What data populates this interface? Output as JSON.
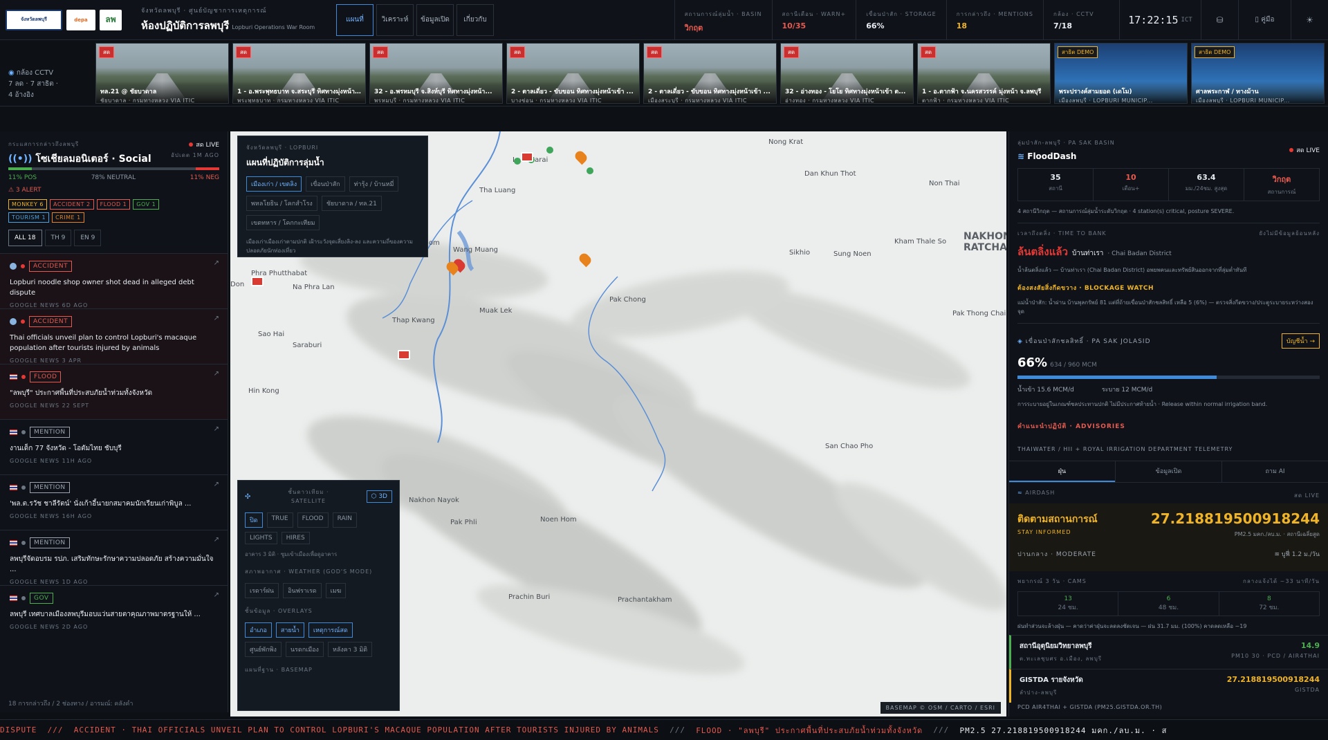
{
  "header": {
    "logos": [
      "จังหวัดลพบุรี",
      "depa",
      "ลพ"
    ],
    "subtitle": "จังหวัดลพบุรี · ศูนย์บัญชาการเหตุการณ์",
    "title": "ห้องปฏิบัติการลพบุรี",
    "title_en": "Lopburi Operations War Room",
    "tabs": [
      "แผนที่",
      "วิเคราะห์",
      "ข้อมูลเปิด",
      "เกี่ยวกับ"
    ],
    "stats": [
      {
        "label": "สถานการณ์ลุ่มน้ำ · BASIN",
        "value": "วิกฤต",
        "color": "#e85a4f"
      },
      {
        "label": "สถานีเตือน · WARN+",
        "value": "10/35",
        "color": "#e85a4f"
      },
      {
        "label": "เขื่อนป่าสัก · STORAGE",
        "value": "66%",
        "color": "#e8edf2"
      },
      {
        "label": "การกล่าวถึง · MENTIONS",
        "value": "18",
        "color": "#f0b429"
      },
      {
        "label": "กล้อง · CCTV",
        "value": "7/18",
        "color": "#e8edf2"
      }
    ],
    "clock": "17:22:15",
    "tz": "ICT",
    "manual_label": "คู่มือ",
    "icons": [
      "database-icon",
      "book-icon",
      "sun-icon"
    ]
  },
  "cctv": {
    "label": "กล้อง CCTV",
    "summary1": "7 ลด · 7 สาธิต ·",
    "summary2": "4 อ้างอิง",
    "cams": [
      {
        "badge": "สด",
        "title": "ทล.21 @ ชัยบาดาล",
        "sub": "ชัยบาดาล · กรมทางหลวง VIA ITIC",
        "demo": false
      },
      {
        "badge": "สด",
        "title": "1 - อ.พระพุทธบาท จ.สระบุรี ทิศทางมุ่งหน้า...",
        "sub": "พระพุทธบาท · กรมทางหลวง VIA ITIC",
        "demo": false
      },
      {
        "badge": "สด",
        "title": "32 - อ.พรหมบุรี จ.สิงห์บุรี ทิศทางมุ่งหน้า...",
        "sub": "พรหมบุรี · กรมทางหลวง VIA ITIC",
        "demo": false
      },
      {
        "badge": "สด",
        "title": "2 - ตาลเดี่ยว - ขับขอน ทิศทางมุ่งหน้าเข้า ...",
        "sub": "บางซ่อน · กรมทางหลวง VIA ITIC",
        "demo": false
      },
      {
        "badge": "สด",
        "title": "2 - ตาลเดี่ยว - ขับขอน ทิศทางมุ่งหน้าเข้า ...",
        "sub": "เมืองสระบุรี · กรมทางหลวง VIA ITIC",
        "demo": false
      },
      {
        "badge": "สด",
        "title": "32 - อ่างทอง - โยโย ทิศทางมุ่งหน้าเข้า ต...",
        "sub": "อ่างทอง · กรมทางหลวง VIA ITIC",
        "demo": false
      },
      {
        "badge": "สด",
        "title": "1 - อ.ตากฟ้า จ.นครสวรรค์ มุ่งหน้า จ.ลพบุรี",
        "sub": "ตากฟ้า · กรมทางหลวง VIA ITIC",
        "demo": false
      },
      {
        "badge": "สาธิต DEMO",
        "title": "พระปรางค์สามยอด (เดโม)",
        "sub": "เมืองลพบุรี · LOPBURI MUNICIP...",
        "demo": true
      },
      {
        "badge": "สาธิต DEMO",
        "title": "ศาลพระกาฬ / ทางม้าน",
        "sub": "เมืองลพบุรี · LOPBURI MUNICIP...",
        "demo": true
      }
    ]
  },
  "social": {
    "kicker": "กระแสการกล่าวถึงลพบุรี",
    "title": "โซเชียลมอนิเตอร์ · Social",
    "live": "สด LIVE",
    "ago": "อัปเดต 1M AGO",
    "sentiment": {
      "pos": 11,
      "neutral": 78,
      "neg": 11
    },
    "pos_label": "11% POS",
    "neutral_label": "78% NEUTRAL",
    "neg_label": "11% NEG",
    "alert": "⚠ 3 ALERT",
    "tags": [
      {
        "label": "MONKEY 6",
        "color": "#f0b429"
      },
      {
        "label": "ACCIDENT 2",
        "color": "#e85a4f"
      },
      {
        "label": "FLOOD 1",
        "color": "#e85a4f"
      },
      {
        "label": "GOV 1",
        "color": "#4caf50"
      },
      {
        "label": "TOURISM 1",
        "color": "#4aa3df"
      },
      {
        "label": "CRIME 1",
        "color": "#e8821c"
      }
    ],
    "filters": [
      "ALL 18",
      "TH 9",
      "EN 9"
    ],
    "items": [
      {
        "cat": "ACCIDENT",
        "cat_color": "#e85a4f",
        "headline": "Lopburi noodle shop owner shot dead in alleged debt dispute",
        "src": "GOOGLE NEWS  6D AGO",
        "lang": "en",
        "hot": true
      },
      {
        "cat": "ACCIDENT",
        "cat_color": "#e85a4f",
        "headline": "Thai officials unveil plan to control Lopburi's macaque population after tourists injured by animals",
        "src": "GOOGLE NEWS  3 APR",
        "lang": "en",
        "hot": true
      },
      {
        "cat": "FLOOD",
        "cat_color": "#e85a4f",
        "headline": "\"ลพบุรี\" ประกาศพื้นที่ประสบภัยน้ำท่วมทั้งจังหวัด",
        "src": "GOOGLE NEWS  22 SEPT",
        "lang": "th",
        "hot": true
      },
      {
        "cat": "MENTION",
        "cat_color": "#9aa5b1",
        "headline": "งานเด็ก 77 จังหวัด - โอตัมไทย ชับบุรี",
        "src": "GOOGLE NEWS  11H AGO",
        "lang": "th",
        "hot": false
      },
      {
        "cat": "MENTION",
        "cat_color": "#9aa5b1",
        "headline": "'พล.ต.รวัช ชาลีรัตน์' นั่งเก้าอี้นายกสมาคมนักเรียนเก่าพิบูล ...",
        "src": "GOOGLE NEWS  16H AGO",
        "lang": "th",
        "hot": false
      },
      {
        "cat": "MENTION",
        "cat_color": "#9aa5b1",
        "headline": "ลพบุรีจัดอบรม รปภ. เสริมทักษะรักษาความปลอดภัย สร้างความมั่นใจ ...",
        "src": "GOOGLE NEWS  1D AGO",
        "lang": "th",
        "hot": false
      },
      {
        "cat": "GOV",
        "cat_color": "#4caf50",
        "headline": "ลพบุรี เทศบาลเมืองลพบุรีมอบแว่นสายตาคุณภาพมาตรฐานให้ ...",
        "src": "GOOGLE NEWS  2D AGO",
        "lang": "th",
        "hot": false
      }
    ],
    "footer": "18 การกล่าวถึง / 2 ช่องทาง / อารมณ์: คลังคำ"
  },
  "map": {
    "ops": {
      "kicker": "จังหวัดลพบุรี · LOPBURI",
      "title": "แผนที่ปฏิบัติการลุ่มน้ำ",
      "chips": [
        "เมืองเก่า / เขตลิง",
        "เขื่อนป่าสัก",
        "ท่ารุ้ง / บ้านหมี่",
        "พหลโยธิน / โคกสำโรง",
        "ชัยบาดาล / ทล.21",
        "เขตทหาร / โคกกะเทียม"
      ],
      "desc": "เมืองเก่าเมืองเก่าตามปกติ เฝ้าระวังจุดเสี่ยงลิง-ลง และความถี่ของความปลอดภัยนักท่องเที่ยว"
    },
    "places": [
      {
        "name": "Nong Krat",
        "cls": "p1"
      },
      {
        "name": "Lam Narai",
        "cls": "p2"
      },
      {
        "name": "Dan Khun Thot",
        "cls": "p3"
      },
      {
        "name": "Non Thai",
        "cls": "p4"
      },
      {
        "name": "Tha Luang",
        "cls": "p5"
      },
      {
        "name": "Phatthana Nikhom",
        "cls": "p6"
      },
      {
        "name": "Wang Muang",
        "cls": "p7"
      },
      {
        "name": "Sikhio",
        "cls": "p8"
      },
      {
        "name": "Sung Noen",
        "cls": "p9"
      },
      {
        "name": "Kham Thale So",
        "cls": "p10"
      },
      {
        "name": "NAKHON",
        "cls": "p11"
      },
      {
        "name": "RATCHA",
        "cls": "p12"
      },
      {
        "name": "Phra Phutthabat",
        "cls": "p13"
      },
      {
        "name": "Na Phra Lan",
        "cls": "p14"
      },
      {
        "name": "Don",
        "cls": "p15"
      },
      {
        "name": "Pak Chong",
        "cls": "p16"
      },
      {
        "name": "Muak Lek",
        "cls": "p17"
      },
      {
        "name": "Pak Thong Chai",
        "cls": "p18"
      },
      {
        "name": "Thap Kwang",
        "cls": "p19"
      },
      {
        "name": "Sao Hai",
        "cls": "p20"
      },
      {
        "name": "Saraburi",
        "cls": "p21"
      },
      {
        "name": "Hin Kong",
        "cls": "p22"
      },
      {
        "name": "San Chao Pho",
        "cls": "p23"
      },
      {
        "name": "Nakhon Nayok",
        "cls": "p24"
      },
      {
        "name": "Pak Phli",
        "cls": "p25"
      },
      {
        "name": "Noen Hom",
        "cls": "p26"
      },
      {
        "name": "Prachin Buri",
        "cls": "p27"
      },
      {
        "name": "Prachantakham",
        "cls": "p28"
      }
    ],
    "satellite": {
      "kicker": "ชั้นดาวเทียม · SATELLITE",
      "btn3d": "⬡ 3D",
      "modes": [
        "ปิด",
        "TRUE",
        "FLOOD",
        "RAIN",
        "LIGHTS",
        "HIRES"
      ],
      "note": "อาคาร 3 มิติ · ซูมเข้าเมืองเพื่อดูอาคาร",
      "weather_label": "สภาพอากาศ · WEATHER (GOD'S MODE)",
      "weather": [
        "เรดาร์ฝน",
        "อินฟราเรด",
        "เมฆ"
      ],
      "overlay_label": "ชั้นข้อมูล · OVERLAYS",
      "overlays": [
        "อำเภอ",
        "สายน้ำ",
        "เหตุการณ์สด",
        "ศูนย์พักพิง",
        "นรดกเมือง",
        "หลังคา 3 มิติ"
      ],
      "basemap_label": "แผนที่ฐาน · BASEMAP"
    },
    "attribution": "BASEMAP © OSM / CARTO / ESRI"
  },
  "right": {
    "flood": {
      "kicker": "ลุ่มป่าสัก-ลพบุรี · PA SAK BASIN",
      "title": "FloodDash",
      "live": "สด LIVE",
      "stats": [
        {
          "v": "35",
          "l": "สถานี",
          "c": "#e8edf2"
        },
        {
          "v": "10",
          "l": "เตือน+",
          "c": "#e85a4f"
        },
        {
          "v": "63.4",
          "l": "มม./24ชม. สูงสุด",
          "c": "#e8edf2"
        },
        {
          "v": "วิกฤต",
          "l": "สถานการณ์",
          "c": "#e85a4f"
        }
      ],
      "summary": "4 สถานีวิกฤต — สถานการณ์ลุ่มน้ำระดับวิกฤต · 4 station(s) critical, posture SEVERE.",
      "bank_kicker": "เวลาถึงตลิ่ง · TIME TO BANK",
      "bank_right": "ยังไม่มีข้อมูลย้อนหลัง",
      "bank": "ล้นตลิ่งแล้ว",
      "bank_place": "บ้านท่าเรา",
      "bank_place_en": "· Chai Badan District",
      "bank_note": "น้ำล้นตลิ่งแล้ว — บ้านท่าเรา (Chai Badan District) อพยพคนและทรัพย์สินออกจากที่ลุ่มต่ำทันที",
      "blockage_title": "ต้องสงสัยสิ่งกีดขวาง · BLOCKAGE WATCH",
      "blockage_note": "แม่น้ำป่าสัก: น้ำผ่าน บ้านพุลกรัพย์ 81 แต่ที่ถ้ายเขื่อนป่าสักชลสิทธิ์ เหลือ 5 (6%) — ตรวจสิ่งกีดขวาง/ประตูระบายระหว่างสองจุด"
    },
    "dam": {
      "title": "เขื่อนป่าสักชลสิทธิ์ · PA SAK JOLASID",
      "btn": "บัญชีน้ำ →",
      "pct": "66%",
      "pct_value": 66,
      "detail": "634 / 960 MCM",
      "inflow": "น้ำเข้า  15.6 MCM/d",
      "outflow": "ระบาย  12 MCM/d",
      "note": "การระบายอยู่ในเกณฑ์ชลประทานปกติ ไม่มีประกาศท้ายน้ำ · Release within normal irrigation band."
    },
    "advisories": "คำแนะนำปฏิบัติ · ADVISORIES",
    "telemetry": "THAIWATER / HII + ROYAL IRRIGATION DEPARTMENT TELEMETRY",
    "tabs": [
      "ฝุ่น",
      "ข้อมูลเปิด",
      "ถาม AI"
    ],
    "air": {
      "label": "AIRDASH",
      "live": "สด LIVE",
      "status": "ติดตามสถานการณ์",
      "status_en": "STAY INFORMED",
      "pm": "27.218819500918244",
      "unit": "PM2.5 มคก./ลบ.ม. · สถานีเฉลี่ยสูด",
      "level": "ปานกลาง · MODERATE",
      "wind": "≋ บูฟี่ 1.2 ม./วัน",
      "forecast_label": "พยากรณ์ 3 วัน · CAMS",
      "forecast_right": "กลางแจ้งได้ ~33 นาที/วัน",
      "forecast": [
        {
          "v": "13",
          "l": "24 ชม."
        },
        {
          "v": "6",
          "l": "48 ชม."
        },
        {
          "v": "8",
          "l": "72 ชม."
        }
      ],
      "forecast_note": "ฝนทำส่วนจะล้างฝุ่น — คาดว่าค่าฝุ่นจะลดลงชัดเจน — ฝน 31.7 มม. (100%) คาดลดเหลือ ~19",
      "stations": [
        {
          "name": "สถานีอุตุนิยมวิทยาลพบุรี",
          "sub": "ต.ทะเลชุบศร อ.เมือง, ลพบุรี",
          "val": "14.9",
          "unit": "PM10 30 · PCD / AIR4THAI",
          "color": "#4caf50"
        },
        {
          "name": "GISTDA รายจังหวัด",
          "sub": "ลำปาง-ลพบุรี",
          "val": "27.218819500918244",
          "unit": "GISTDA",
          "color": "#f0b429"
        }
      ],
      "source": "PCD AIR4THAI + GISTDA (PM25.GISTDA.OR.TH)"
    }
  },
  "ticker": {
    "segments": [
      {
        "text": "DISPUTE  ///  ",
        "color": "#e85a4f"
      },
      {
        "text": "ACCIDENT · THAI OFFICIALS UNVEIL PLAN TO CONTROL LOPBURI'S MACAQUE POPULATION AFTER TOURISTS INJURED BY ANIMALS",
        "color": "#e85a4f"
      },
      {
        "text": "  ///  ",
        "color": "#6c7784"
      },
      {
        "text": "FLOOD · \"ลพบุรี\" ประกาศพื้นที่ประสบภัยน้ำท่วมทั้งจังหวัด",
        "color": "#e85a4f"
      },
      {
        "text": "  ///  ",
        "color": "#6c7784"
      },
      {
        "text": "PM2.5 27.218819500918244 มคก./ลบ.ม. · ส",
        "color": "#e8edf2"
      }
    ]
  }
}
